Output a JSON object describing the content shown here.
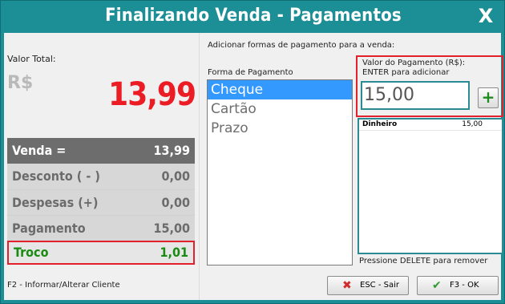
{
  "window": {
    "title": "Finalizando Venda - Pagamentos",
    "close_label": "X"
  },
  "left": {
    "total_label": "Valor Total:",
    "currency": "R$",
    "total_value": "13,99",
    "rows": [
      {
        "key": "Venda =",
        "value": "13,99"
      },
      {
        "key": "Desconto ( - )",
        "value": "0,00"
      },
      {
        "key": "Despesas (+)",
        "value": "0,00"
      },
      {
        "key": "Pagamento",
        "value": "15,00"
      },
      {
        "key": "Troco",
        "value": "1,01"
      }
    ],
    "hint": "F2 - Informar/Alterar Cliente"
  },
  "right": {
    "add_label": "Adicionar formas de pagamento para a venda:",
    "forma_label": "Forma de Pagamento",
    "methods": [
      "Cheque",
      "Cartão",
      "Prazo"
    ],
    "valor_label": "Valor do Pagamento (R$):",
    "enter_label": "ENTER para adicionar",
    "input_value": "15,00",
    "add_button": "+",
    "payments": [
      {
        "name": "Dinheiro",
        "amount": "15,00"
      }
    ],
    "delete_hint": "Pressione DELETE para remover"
  },
  "buttons": {
    "esc_label": "ESC - Sair",
    "ok_label": "F3 - OK"
  },
  "colors": {
    "title_bar": "#1c8f96",
    "total": "#ec1c24",
    "troco": "#1a8b12",
    "highlight_border": "#e1212b"
  }
}
